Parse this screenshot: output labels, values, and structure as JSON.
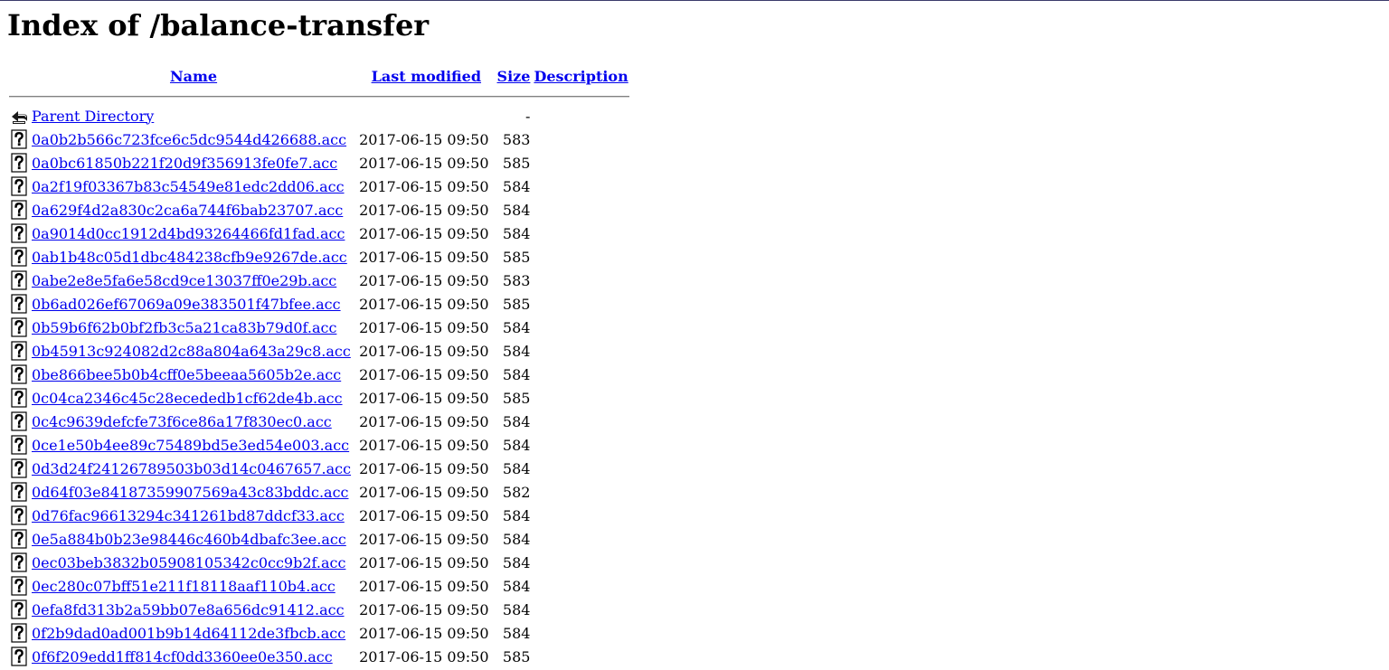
{
  "page_title": "Index of /balance-transfer",
  "columns": {
    "name": "Name",
    "last_modified": "Last modified",
    "size": "Size",
    "description": "Description"
  },
  "parent": {
    "label": "Parent Directory",
    "size": "-",
    "icon": "back-arrow-icon"
  },
  "file_icon": "unknown-file-icon",
  "files": [
    {
      "name": "0a0b2b566c723fce6c5dc9544d426688.acc",
      "modified": "2017-06-15 09:50",
      "size": "583"
    },
    {
      "name": "0a0bc61850b221f20d9f356913fe0fe7.acc",
      "modified": "2017-06-15 09:50",
      "size": "585"
    },
    {
      "name": "0a2f19f03367b83c54549e81edc2dd06.acc",
      "modified": "2017-06-15 09:50",
      "size": "584"
    },
    {
      "name": "0a629f4d2a830c2ca6a744f6bab23707.acc",
      "modified": "2017-06-15 09:50",
      "size": "584"
    },
    {
      "name": "0a9014d0cc1912d4bd93264466fd1fad.acc",
      "modified": "2017-06-15 09:50",
      "size": "584"
    },
    {
      "name": "0ab1b48c05d1dbc484238cfb9e9267de.acc",
      "modified": "2017-06-15 09:50",
      "size": "585"
    },
    {
      "name": "0abe2e8e5fa6e58cd9ce13037ff0e29b.acc",
      "modified": "2017-06-15 09:50",
      "size": "583"
    },
    {
      "name": "0b6ad026ef67069a09e383501f47bfee.acc",
      "modified": "2017-06-15 09:50",
      "size": "585"
    },
    {
      "name": "0b59b6f62b0bf2fb3c5a21ca83b79d0f.acc",
      "modified": "2017-06-15 09:50",
      "size": "584"
    },
    {
      "name": "0b45913c924082d2c88a804a643a29c8.acc",
      "modified": "2017-06-15 09:50",
      "size": "584"
    },
    {
      "name": "0be866bee5b0b4cff0e5beeaa5605b2e.acc",
      "modified": "2017-06-15 09:50",
      "size": "584"
    },
    {
      "name": "0c04ca2346c45c28ecededb1cf62de4b.acc",
      "modified": "2017-06-15 09:50",
      "size": "585"
    },
    {
      "name": "0c4c9639defcfe73f6ce86a17f830ec0.acc",
      "modified": "2017-06-15 09:50",
      "size": "584"
    },
    {
      "name": "0ce1e50b4ee89c75489bd5e3ed54e003.acc",
      "modified": "2017-06-15 09:50",
      "size": "584"
    },
    {
      "name": "0d3d24f24126789503b03d14c0467657.acc",
      "modified": "2017-06-15 09:50",
      "size": "584"
    },
    {
      "name": "0d64f03e84187359907569a43c83bddc.acc",
      "modified": "2017-06-15 09:50",
      "size": "582"
    },
    {
      "name": "0d76fac96613294c341261bd87ddcf33.acc",
      "modified": "2017-06-15 09:50",
      "size": "584"
    },
    {
      "name": "0e5a884b0b23e98446c460b4dbafc3ee.acc",
      "modified": "2017-06-15 09:50",
      "size": "584"
    },
    {
      "name": "0ec03beb3832b05908105342c0cc9b2f.acc",
      "modified": "2017-06-15 09:50",
      "size": "584"
    },
    {
      "name": "0ec280c07bff51e211f18118aaf110b4.acc",
      "modified": "2017-06-15 09:50",
      "size": "584"
    },
    {
      "name": "0efa8fd313b2a59bb07e8a656dc91412.acc",
      "modified": "2017-06-15 09:50",
      "size": "584"
    },
    {
      "name": "0f2b9dad0ad001b9b14d64112de3fbcb.acc",
      "modified": "2017-06-15 09:50",
      "size": "584"
    },
    {
      "name": "0f6f209edd1ff814cf0dd3360ee0e350.acc",
      "modified": "2017-06-15 09:50",
      "size": "585"
    }
  ]
}
